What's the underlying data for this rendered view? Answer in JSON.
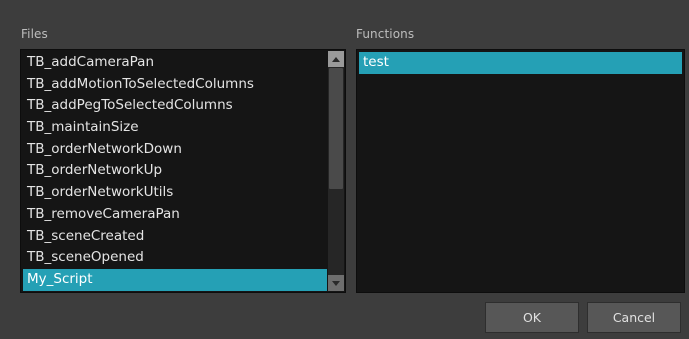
{
  "files": {
    "label": "Files",
    "items": [
      "TB_addCameraPan",
      "TB_addMotionToSelectedColumns",
      "TB_addPegToSelectedColumns",
      "TB_maintainSize",
      "TB_orderNetworkDown",
      "TB_orderNetworkUp",
      "TB_orderNetworkUtils",
      "TB_removeCameraPan",
      "TB_sceneCreated",
      "TB_sceneOpened",
      "My_Script"
    ],
    "selected_index": 10
  },
  "functions": {
    "label": "Functions",
    "items": [
      "test"
    ],
    "selected_index": 0
  },
  "buttons": {
    "ok": "OK",
    "cancel": "Cancel"
  },
  "colors": {
    "selection": "#25a0b5",
    "list_background": "#151515",
    "dialog_background": "#3d3d3d"
  }
}
